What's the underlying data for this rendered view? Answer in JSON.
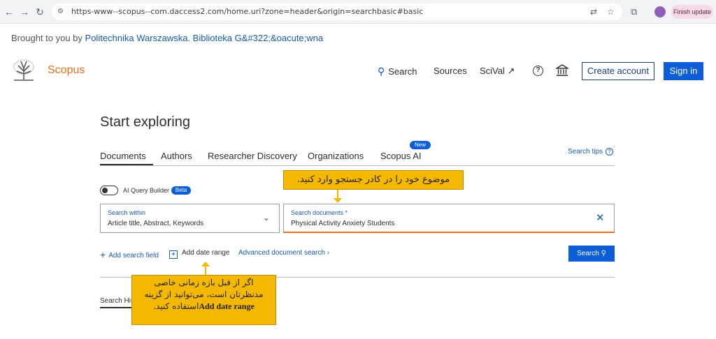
{
  "browser": {
    "url": "https-www--scopus--com.daccess2.com/home.uri?zone=header&origin=searchbasic#basic",
    "update_label": "Finish update"
  },
  "banner": {
    "prefix": "Brought to you by",
    "institution": "Politechnika Warszawska. Biblioteka G&#322;&oacute;wna"
  },
  "header": {
    "logo": "Scopus",
    "nav": {
      "search": "Search",
      "sources": "Sources",
      "scival": "SciVal ↗"
    },
    "create_account": "Create account",
    "sign_in": "Sign in"
  },
  "main": {
    "title": "Start exploring",
    "tabs": [
      "Documents",
      "Authors",
      "Researcher Discovery",
      "Organizations",
      "Scopus AI"
    ],
    "new_badge": "New",
    "search_tips": "Search tips",
    "ai_query_builder": "AI Query Builder",
    "beta_badge": "Beta",
    "search_within": {
      "label": "Search within",
      "value": "Article title, Abstract, Keywords"
    },
    "search_documents": {
      "label": "Search documents *",
      "value": "Physical Activity Anxiety Students"
    },
    "add_search_field": "Add search field",
    "add_date_range": "Add date range",
    "advanced_search": "Advanced document search ›",
    "search_button": "Search",
    "search_history": "Search His"
  },
  "callouts": {
    "top": "موضوع خود را در کادر جستجو وارد کنید.",
    "bottom_line1": "اگر از قبل بازه زمانی خاصی",
    "bottom_line2": "مدنظرتان است، می‌توانید از گزینه",
    "bottom_bold": "Add date range",
    "bottom_line3_suffix": "استفاده کنید."
  },
  "colors": {
    "primary_blue": "#0b5ed7",
    "link_blue": "#1a5aa8",
    "scopus_orange": "#e9711c",
    "callout_yellow": "#f5b800"
  }
}
